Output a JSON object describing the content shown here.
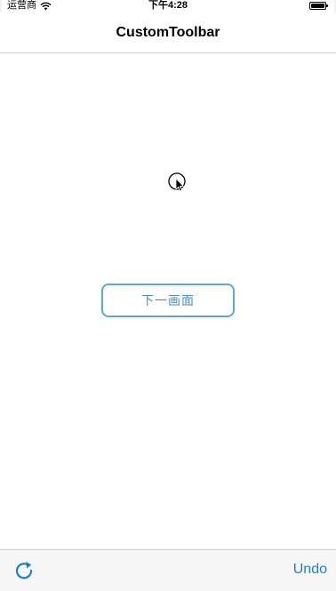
{
  "status_bar": {
    "carrier": "运营商",
    "time": "下午4:28",
    "battery_level": 1.0,
    "wifi_icon": "wifi-icon",
    "battery_icon": "battery-icon"
  },
  "nav_bar": {
    "title": "CustomToolbar"
  },
  "content": {
    "next_button_label": "下一画面",
    "cursor_icon": "mouse-cursor-icon"
  },
  "toolbar": {
    "refresh_icon": "refresh-icon",
    "undo_label": "Undo"
  },
  "colors": {
    "accent": "#1a7fd4",
    "button_border": "#5fa8cf",
    "button_text": "#4a90c8",
    "toolbar_bg": "#f7f7f7"
  }
}
